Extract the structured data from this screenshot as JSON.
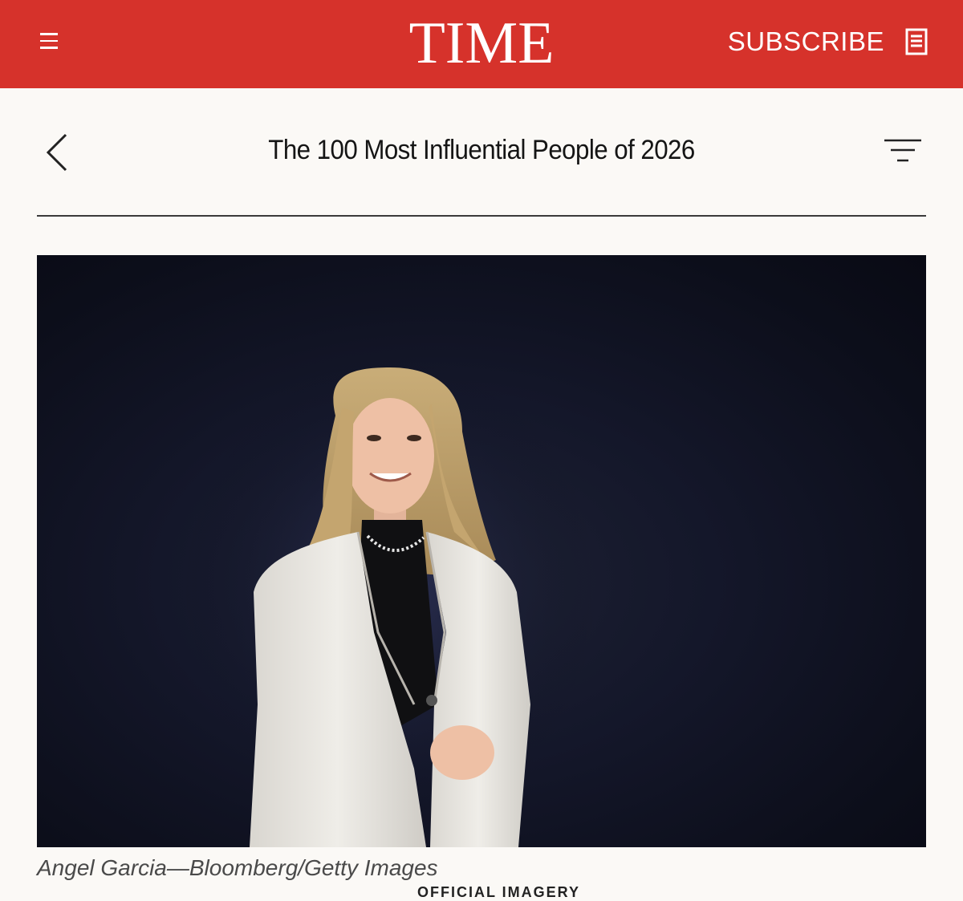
{
  "header": {
    "logo": "TIME",
    "subscribe_label": "SUBSCRIBE",
    "brand_color": "#d6322b",
    "menu_icon": "hamburger-menu-icon",
    "magazine_icon": "magazine-icon"
  },
  "section": {
    "title": "The 100 Most Influential People of 2026",
    "back_icon": "chevron-left-icon",
    "filter_icon": "filter-icon"
  },
  "photo": {
    "caption": "Angel Garcia—Bloomberg/Getty Images"
  },
  "kicker": {
    "text": "OFFICIAL IMAGERY"
  }
}
